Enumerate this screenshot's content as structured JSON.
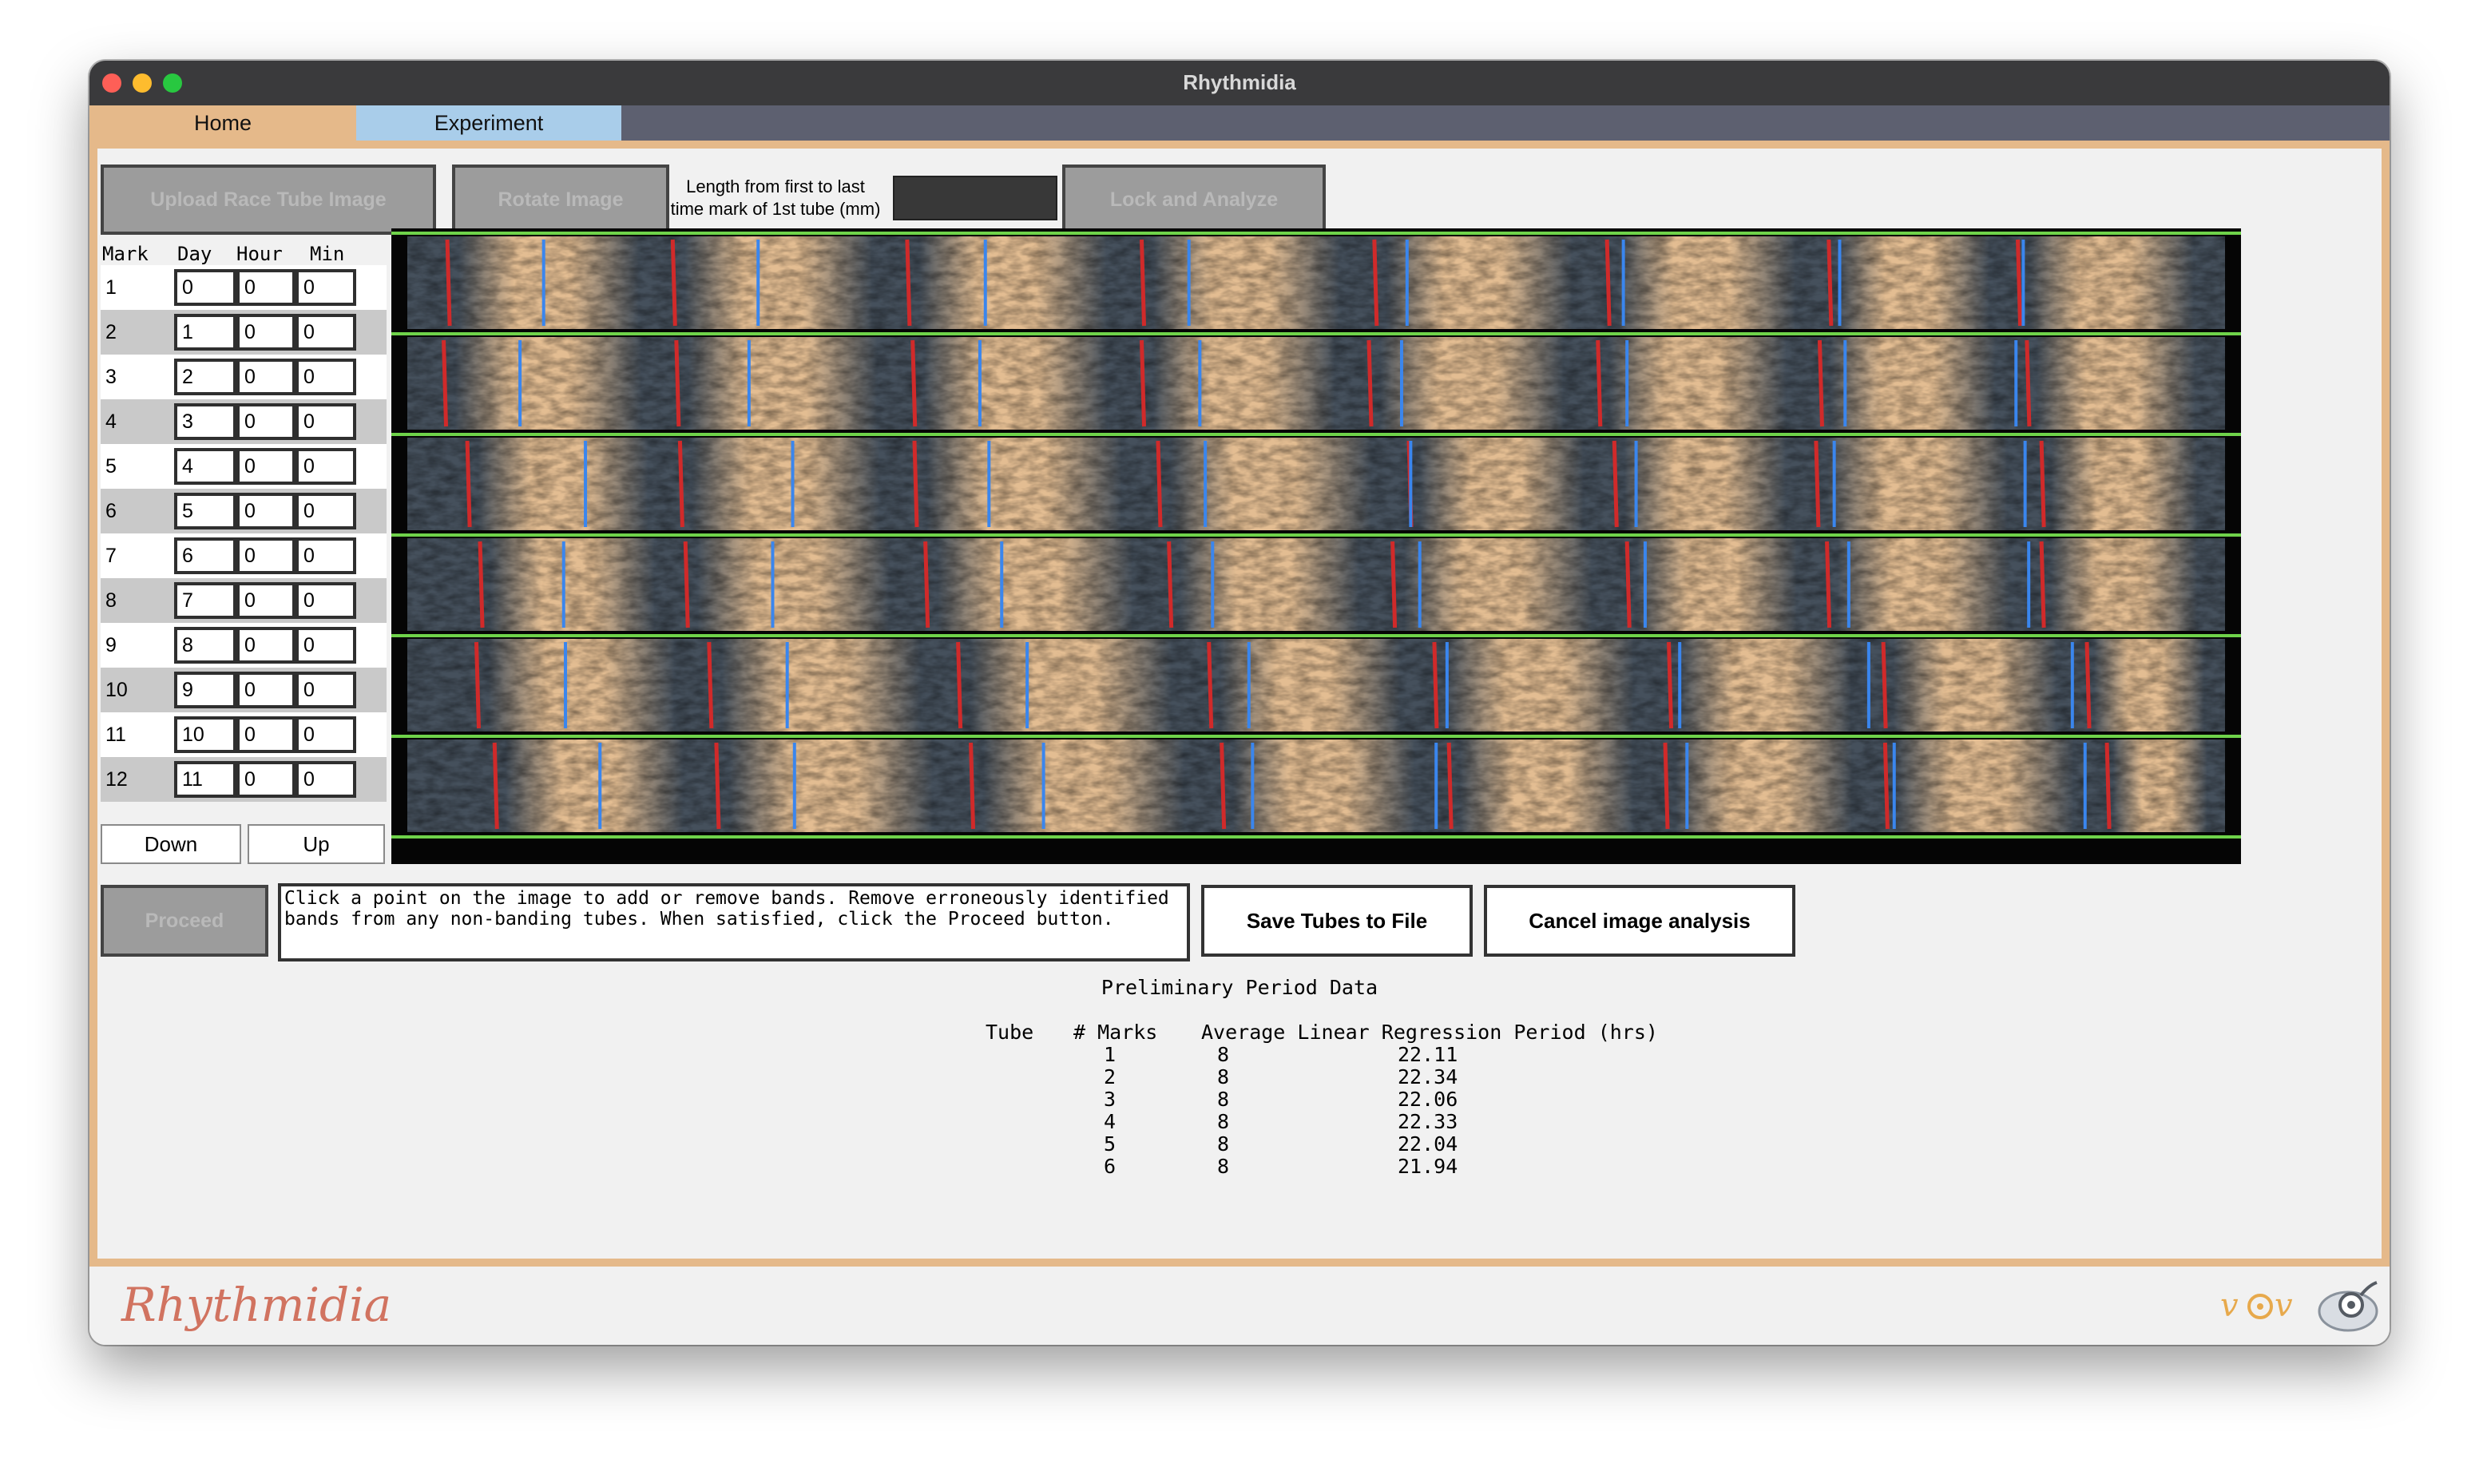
{
  "window": {
    "title": "Rhythmidia"
  },
  "tabs": [
    {
      "label": "Home"
    },
    {
      "label": "Experiment"
    }
  ],
  "toolbar": {
    "upload_label": "Upload Race Tube Image",
    "rotate_label": "Rotate Image",
    "length_label_line1": "Length from first to last",
    "length_label_line2": "time mark of 1st tube (mm)",
    "length_value": "",
    "lock_label": "Lock and Analyze"
  },
  "marks_table": {
    "headers": [
      "Mark",
      "Day",
      "Hour",
      "Min"
    ],
    "rows": [
      {
        "mark": "1",
        "day": "0",
        "hour": "0",
        "min": "0"
      },
      {
        "mark": "2",
        "day": "1",
        "hour": "0",
        "min": "0"
      },
      {
        "mark": "3",
        "day": "2",
        "hour": "0",
        "min": "0"
      },
      {
        "mark": "4",
        "day": "3",
        "hour": "0",
        "min": "0"
      },
      {
        "mark": "5",
        "day": "4",
        "hour": "0",
        "min": "0"
      },
      {
        "mark": "6",
        "day": "5",
        "hour": "0",
        "min": "0"
      },
      {
        "mark": "7",
        "day": "6",
        "hour": "0",
        "min": "0"
      },
      {
        "mark": "8",
        "day": "7",
        "hour": "0",
        "min": "0"
      },
      {
        "mark": "9",
        "day": "8",
        "hour": "0",
        "min": "0"
      },
      {
        "mark": "10",
        "day": "9",
        "hour": "0",
        "min": "0"
      },
      {
        "mark": "11",
        "day": "10",
        "hour": "0",
        "min": "0"
      },
      {
        "mark": "12",
        "day": "11",
        "hour": "0",
        "min": "0"
      }
    ],
    "down_label": "Down",
    "up_label": "Up"
  },
  "race_tubes": [
    {
      "tube": 1,
      "time_marks": [
        0.022,
        0.146,
        0.275,
        0.404,
        0.532,
        0.66,
        0.782,
        0.886
      ],
      "bands": [
        0.075,
        0.193,
        0.318,
        0.43,
        0.55,
        0.669,
        0.788,
        0.889
      ]
    },
    {
      "tube": 2,
      "time_marks": [
        0.02,
        0.148,
        0.278,
        0.404,
        0.529,
        0.655,
        0.777,
        0.891
      ],
      "bands": [
        0.062,
        0.188,
        0.315,
        0.436,
        0.547,
        0.671,
        0.791,
        0.885
      ]
    },
    {
      "tube": 3,
      "time_marks": [
        0.033,
        0.15,
        0.279,
        0.413,
        0.551,
        0.664,
        0.775,
        0.899
      ],
      "bands": [
        0.098,
        0.212,
        0.32,
        0.439,
        0.552,
        0.676,
        0.785,
        0.89
      ]
    },
    {
      "tube": 4,
      "time_marks": [
        0.04,
        0.153,
        0.285,
        0.419,
        0.542,
        0.671,
        0.781,
        0.899
      ],
      "bands": [
        0.086,
        0.201,
        0.327,
        0.443,
        0.557,
        0.681,
        0.793,
        0.892
      ]
    },
    {
      "tube": 5,
      "time_marks": [
        0.038,
        0.166,
        0.303,
        0.441,
        0.565,
        0.694,
        0.812,
        0.924
      ],
      "bands": [
        0.087,
        0.209,
        0.341,
        0.463,
        0.572,
        0.7,
        0.804,
        0.916
      ]
    },
    {
      "tube": 6,
      "time_marks": [
        0.048,
        0.17,
        0.31,
        0.448,
        0.573,
        0.692,
        0.813,
        0.935
      ],
      "bands": [
        0.106,
        0.213,
        0.35,
        0.465,
        0.566,
        0.704,
        0.818,
        0.923
      ]
    }
  ],
  "instructions": "Click a point on the image to add or remove bands. Remove erroneously identified bands from any non-banding tubes. When satisfied, click the Proceed button.",
  "actions": {
    "proceed_label": "Proceed",
    "save_label": "Save Tubes to File",
    "cancel_label": "Cancel image analysis"
  },
  "preliminary": {
    "title": "Preliminary Period Data",
    "headers": [
      "Tube",
      "# Marks",
      "Average Linear Regression Period (hrs)"
    ],
    "rows": [
      {
        "tube": "1",
        "marks": "8",
        "period": "22.11"
      },
      {
        "tube": "2",
        "marks": "8",
        "period": "22.34"
      },
      {
        "tube": "3",
        "marks": "8",
        "period": "22.06"
      },
      {
        "tube": "4",
        "marks": "8",
        "period": "22.33"
      },
      {
        "tube": "5",
        "marks": "8",
        "period": "22.04"
      },
      {
        "tube": "6",
        "marks": "8",
        "period": "21.94"
      }
    ]
  },
  "footer": {
    "logo_text": "Rhythmidia"
  },
  "colors": {
    "accent_border": "#e5b98a",
    "home_tab": "#e5b98a",
    "experiment_tab": "#a9cdea",
    "tube_line": "#6fd34a",
    "time_mark": "#d02a2a",
    "band_line": "#3a86ee",
    "tube_dark": "#45505c",
    "tube_light": "#e3bd92"
  }
}
